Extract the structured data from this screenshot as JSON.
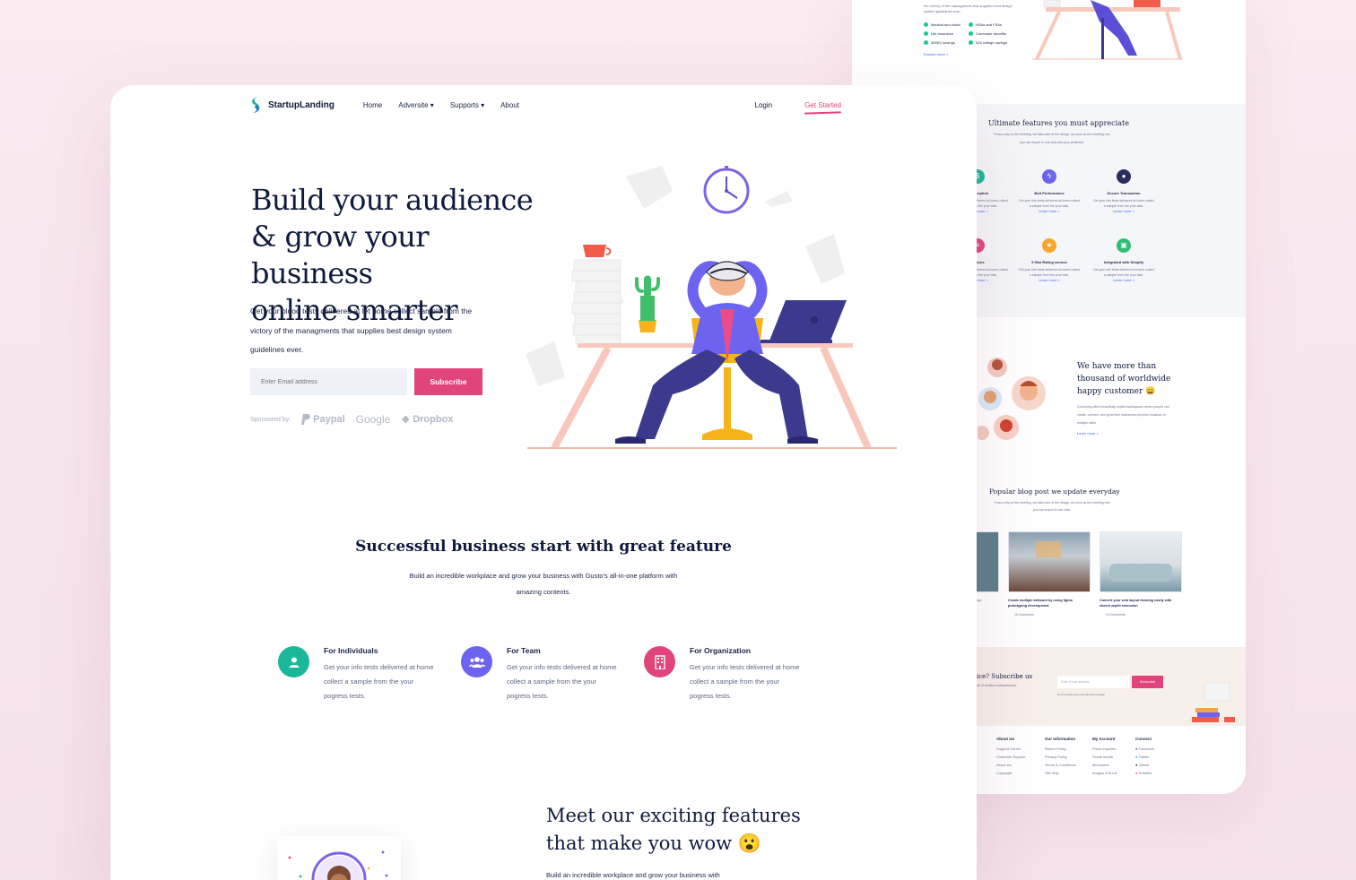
{
  "colors": {
    "accent": "#e0447b",
    "navy": "#0f1a3c",
    "teal": "#1bb79a",
    "purple": "#6c63f0",
    "pink": "#e0447b"
  },
  "back": {
    "intro": "the victory of the managments that supplies best design system guidelines ever.",
    "checklist": [
      "Medical and vision",
      "Life Insurance",
      "400(K) savings",
      "HSAs and FSAs",
      "Commuter benefits",
      "529 college savings"
    ],
    "explore": "Explore more >",
    "features_title": "Ultimate features you must appreciate",
    "features_desc": "Focus only on the meeting, we take care of the design. As soon as the meeting end you can export in one click into your preferred.",
    "features": [
      {
        "label": "Subscription",
        "icon": "subscription-icon"
      },
      {
        "label": "Bolt Performance",
        "icon": "bolt-icon"
      },
      {
        "label": "Secure Transaction",
        "icon": "lock-icon"
      },
      {
        "label": "Options",
        "icon": "options-icon"
      },
      {
        "label": "5 Star Rating service",
        "icon": "star-icon"
      },
      {
        "label": "Integrated with Shopify",
        "icon": "shopify-icon"
      }
    ],
    "feature_desc": "Get your info tests delivered at home collect a sample from the your task.",
    "learn_more": "Learn more >",
    "customers_title": "We have more than thousand of worldwide happy customer 😄",
    "customers_desc": "Coworking offers beautifully crafted workspaces where people can create, connect, and grow their businesses at prime locations in multiple cities.",
    "blog_title": "Popular blog post we update everyday",
    "blog_desc": "Focus only on the meeting, we take care of the design. As soon as the meeting end you can export in one click.",
    "blog_posts": [
      {
        "title": "Create multiple artboard by using figma prototyping development",
        "comments": "15 Comments"
      },
      {
        "title": "Convert your web layout theming easily with sketch zeplin extension",
        "comments": "10 Comments"
      }
    ],
    "blog_partial": "sign",
    "subscribe_title": "ice? Subscribe us",
    "subscribe_sub": "ral of creative entrepreneurs.",
    "subscribe_placeholder": "Enter Email address",
    "subscribe_btn": "Subscribe",
    "subscribe_note": "Don't provide any promotional message",
    "footer": [
      {
        "title": "About Us",
        "items": [
          "Support Center",
          "Customer Support",
          "About Us",
          "Copyright"
        ]
      },
      {
        "title": "Our Information",
        "items": [
          "Return Policy",
          "Privacy Policy",
          "Terms & Conditions",
          "Site Map"
        ]
      },
      {
        "title": "My Account",
        "items": [
          "Press inquiries",
          "Social media",
          "directories",
          "Images & B-roll"
        ]
      },
      {
        "title": "Connect",
        "items": [
          "Facebook",
          "Twitter",
          "Github",
          "Dribbble"
        ]
      }
    ]
  },
  "nav": {
    "brand": "StartupLanding",
    "links": [
      "Home",
      "Adversite ▾",
      "Supports ▾",
      "About"
    ],
    "login": "Login",
    "get_started": "Get Started"
  },
  "hero": {
    "title_lines": [
      "Build your audience",
      "& grow your business",
      "online smarter"
    ],
    "description": "Get your blood tests delivered at let home collect sample from the victory of the managments that supplies best design system guidelines ever.",
    "email_placeholder": "Enter Email address",
    "subscribe": "Subscribe",
    "sponsored_label": "Sponsored by:",
    "sponsors": [
      "Paypal",
      "Google",
      "Dropbox"
    ]
  },
  "section": {
    "title": "Successful business start with great feature",
    "description": "Build an incredible workplace and grow your business with Gusto's all-in-one platform with amazing contents."
  },
  "features": [
    {
      "title": "For Individuals",
      "description": "Get your info tests delivered at home collect a sample from the your pogress tests.",
      "icon": "user-icon"
    },
    {
      "title": "For Team",
      "description": "Get your info tests delivered at home collect a sample from the your pogress tests.",
      "icon": "team-icon"
    },
    {
      "title": "For Organization",
      "description": "Get your info tests delivered at home collect a sample from the your pogress tests.",
      "icon": "building-icon"
    }
  ],
  "meet": {
    "title_line1": "Meet our exciting features",
    "title_line2": "that make you wow 😮",
    "description": "Build an incredible workplace and grow your business with"
  }
}
